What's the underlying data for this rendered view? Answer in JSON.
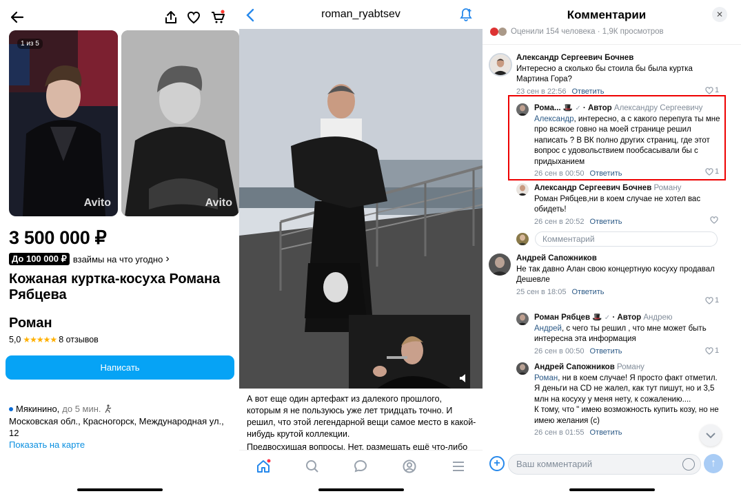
{
  "avito": {
    "photo_counter": "1 из 5",
    "watermark": "Avito",
    "price": "3 500 000 ₽",
    "exchange_tag": "До 100 000 ₽",
    "exchange_text": "взаймы на что угодно",
    "exchange_chevron": "›",
    "title": "Кожаная куртка-косуха Романа Рябцева",
    "seller_name": "Роман",
    "rating_value": "5,0",
    "stars": "★★★★★",
    "reviews": "8 отзывов",
    "write_button": "Написать",
    "metro_station": "Мякинино,",
    "metro_distance": "до 5 мин.",
    "address": "Московская обл., Красногорск, Международная ул., 12",
    "map_link": "Показать на карте",
    "accent_color": "#06a3f5"
  },
  "vk_post": {
    "username": "roman_ryabtsev",
    "text": "А вот еще один артефакт из далекого прошлого, которым я не пользуюсь уже лет тридцать точно. И решил, что этой легендарной вещи самое место в какой-нибудь крутой коллекции.",
    "text_more": "Предвосхищая вопросы. Нет, размешать ещё что-либо",
    "tabs": [
      "home-icon",
      "search-icon",
      "messages-icon",
      "profile-icon",
      "menu-icon"
    ]
  },
  "comments_panel": {
    "title": "Комментарии",
    "likes_line": "Оценили 154 человека · 1,9К просмотров",
    "reply_placeholder": "Комментарий",
    "input_placeholder": "Ваш комментарий",
    "reply_label": "Ответить",
    "comments": [
      {
        "name": "Александр Сергеевич Бочнев",
        "reply_to": "",
        "mention": "",
        "text": "Интересно а сколько бы стоила бы была куртка Мартина Гора?",
        "date": "23 сен в 22:56",
        "likes": "1"
      },
      {
        "name": "Рома...",
        "badge": "· Автор",
        "reply_to": "Александру Сергеевичу",
        "mention": "Александр",
        "text": ", интересно, а с какого перепуга ты мне про всякое говно на моей странице решил написать ? В ВК полно других страниц, где этот вопрос с удовольствием пообсасывали бы с придыханием",
        "date": "26 сен в 00:50",
        "likes": "1"
      },
      {
        "name": "Александр Сергеевич Бочнев",
        "reply_to": "Роману",
        "mention": "",
        "text": "Роман Рябцев,ни в коем случае не хотел вас обидеть!",
        "date": "26 сен в 20:52",
        "likes": ""
      },
      {
        "name": "Андрей Сапожников",
        "reply_to": "",
        "mention": "",
        "text": "Не так давно Алан свою концертную косуху продавал",
        "text2": "Дешевле",
        "date": "25 сен в 18:05",
        "likes": "1"
      },
      {
        "name": "Роман Рябцев",
        "badge": "· Автор",
        "reply_to": "Андрею",
        "mention": "Андрей",
        "text": ", с чего ты решил , что мне может быть интересна эта информация",
        "date": "26 сен в 00:50",
        "likes": "1"
      },
      {
        "name": "Андрей Сапожников",
        "reply_to": "Роману",
        "mention": "Роман",
        "text": ", ни в коем случае! Я просто факт отметил.",
        "text2": "Я деньги на CD не жалел, как тут пишут, но и 3,5 млн на косуху у меня нету, к сожалению....",
        "text3": "К тому, что \" имею возможность купить козу, но не имею желания (с)",
        "date": "26 сен в 01:55",
        "likes": ""
      }
    ]
  }
}
